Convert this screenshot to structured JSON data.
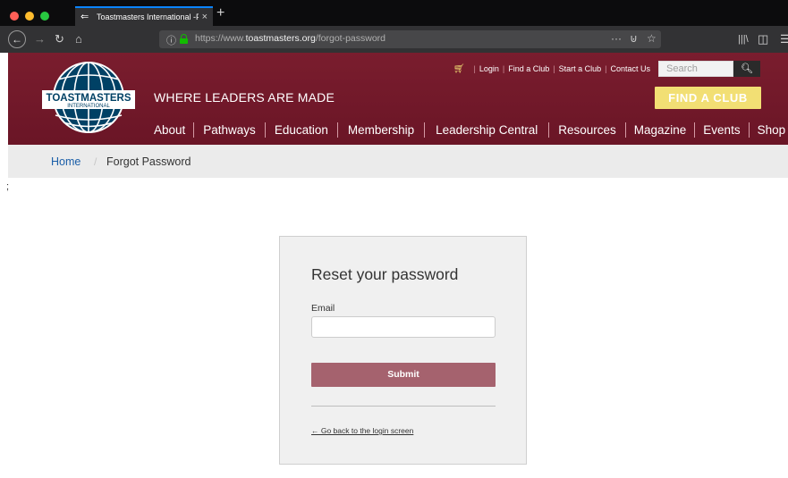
{
  "browser": {
    "tab_title": "Toastmasters International -For",
    "tab_close": "×",
    "new_tab": "+",
    "url_prefix": "https://www.",
    "url_domain": "toastmasters.org",
    "url_path": "/forgot-password",
    "page_actions": "···",
    "traffic_colors": [
      "#ff5f57",
      "#febc2e",
      "#28c840"
    ]
  },
  "header": {
    "utility_links": [
      "Login",
      "Find a Club",
      "Start a Club",
      "Contact Us"
    ],
    "search_placeholder": "Search",
    "logo_text": "TOASTMASTERS",
    "logo_subtext": "INTERNATIONAL",
    "tagline": "WHERE LEADERS ARE MADE",
    "cta": "FIND A CLUB",
    "nav": [
      "About",
      "Pathways",
      "Education",
      "Membership",
      "Leadership Central",
      "Resources",
      "Magazine",
      "Events",
      "Shop"
    ]
  },
  "breadcrumb": {
    "home": "Home",
    "separator": "/",
    "current": "Forgot Password"
  },
  "stray_text": ";",
  "form": {
    "title": "Reset your password",
    "email_label": "Email",
    "email_value": "",
    "submit_label": "Submit",
    "back_link": "← Go back to the login screen"
  },
  "colors": {
    "brand_maroon": "#772432",
    "accent_gold": "#f2df74",
    "submit_button": "#a5626e",
    "link_blue": "#1a5ea8"
  }
}
